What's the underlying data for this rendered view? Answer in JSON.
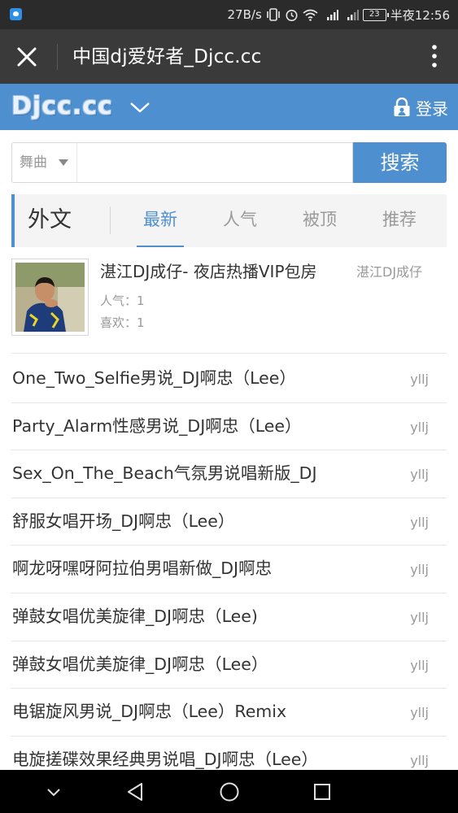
{
  "status_bar": {
    "speed": "27B/s",
    "battery": "23",
    "time": "半夜12:56"
  },
  "browser": {
    "title": "中国dj爱好者_Djcc.cc"
  },
  "site": {
    "logo": "Djcc.cc",
    "login": "登录"
  },
  "search": {
    "category": "舞曲",
    "query": "",
    "button": "搜索"
  },
  "tabs": {
    "section_title": "外文",
    "items": [
      "最新",
      "人气",
      "被顶",
      "推荐"
    ],
    "active": "最新"
  },
  "featured": {
    "title": "湛江DJ成仔- 夜店热播VIP包房",
    "author": "湛江DJ成仔",
    "popularity": "人气：1",
    "likes": "喜欢：1"
  },
  "songs": [
    {
      "title": "One_Two_Selfie男说_DJ啊忠（Lee）",
      "author": "yllj"
    },
    {
      "title": "Party_Alarm性感男说_DJ啊忠（Lee）",
      "author": "yllj"
    },
    {
      "title": "Sex_On_The_Beach气氛男说唱新版_DJ",
      "author": "yllj"
    },
    {
      "title": "舒服女唱开场_DJ啊忠（Lee）",
      "author": "yllj"
    },
    {
      "title": "啊龙呀嘿呀阿拉伯男唱新做_DJ啊忠",
      "author": "yllj"
    },
    {
      "title": "弹鼓女唱优美旋律_DJ啊忠（Lee)",
      "author": "yllj"
    },
    {
      "title": "弹鼓女唱优美旋律_DJ啊忠（Lee）",
      "author": "yllj"
    },
    {
      "title": "电锯旋风男说_DJ啊忠（Lee）Remix",
      "author": "yllj"
    },
    {
      "title": "电旋搓碟效果经典男说唱_DJ啊忠（Lee）",
      "author": "yllj"
    }
  ],
  "colors": {
    "brand": "#4e8fcf",
    "status_bar": "#2b2b2b",
    "browser_bar": "#3a3a3a"
  },
  "icons": {
    "close": "close-icon",
    "more": "more-vertical-icon",
    "menu": "chevron-down-icon",
    "login": "lock-user-icon",
    "back": "back-triangle-icon",
    "home": "home-circle-icon",
    "recents": "recents-square-icon",
    "hide": "hide-nav-chevron-icon"
  }
}
